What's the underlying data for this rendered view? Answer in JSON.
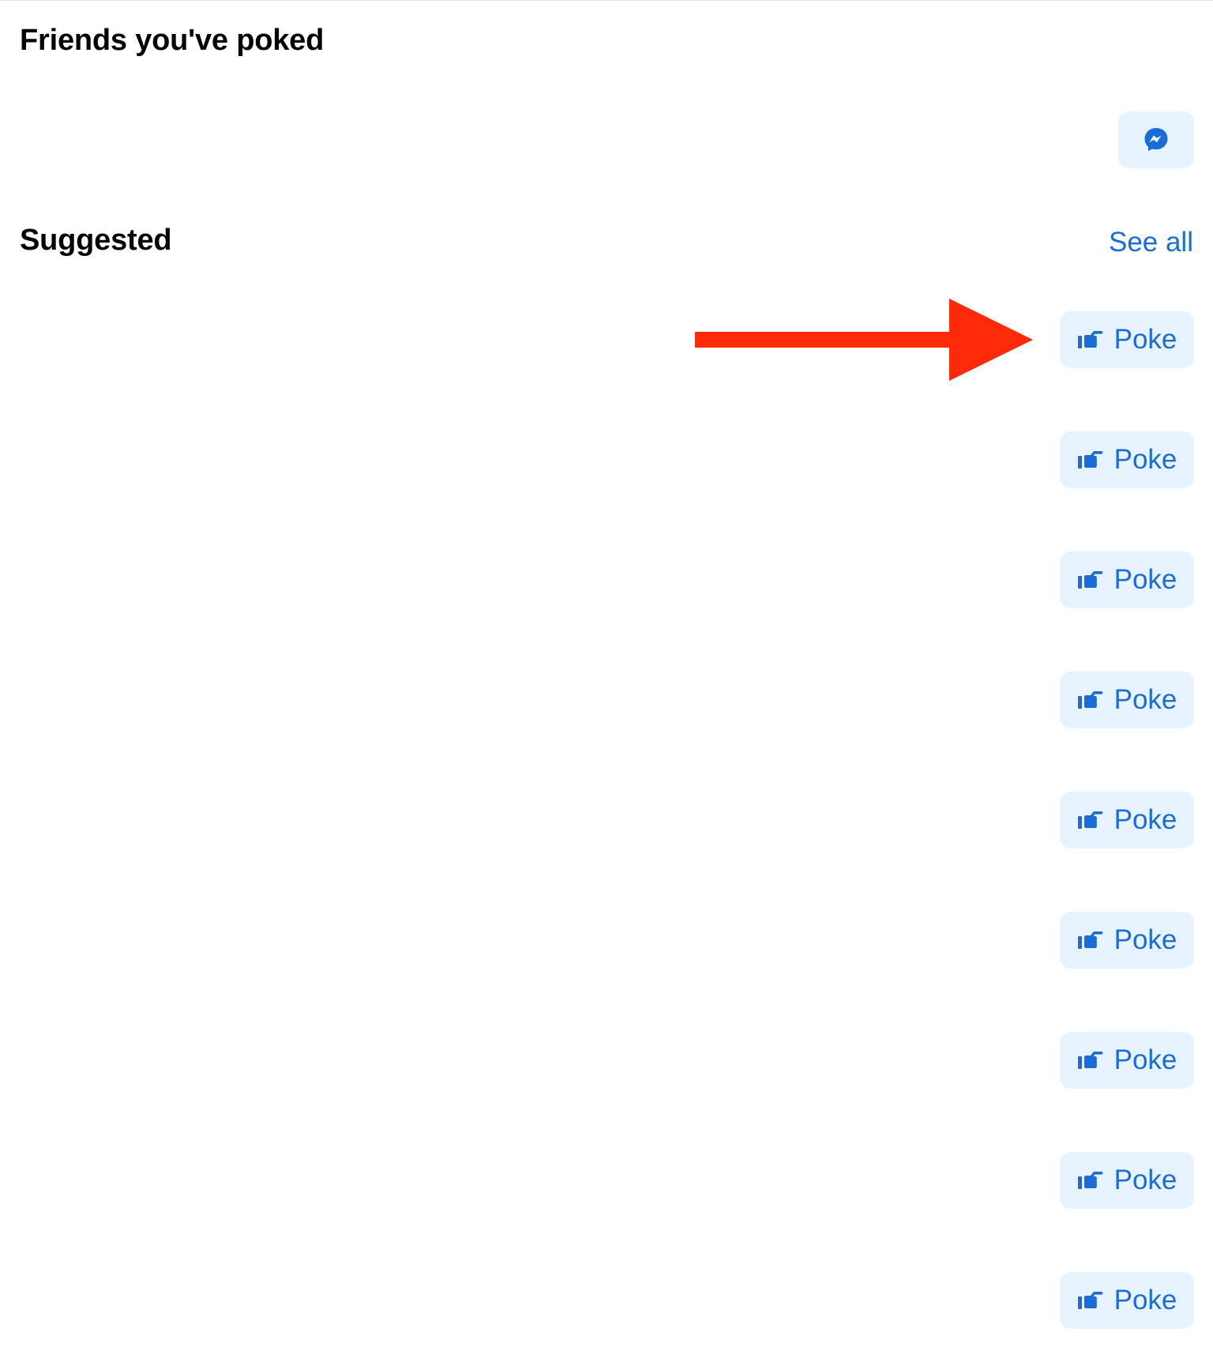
{
  "sections": {
    "poked_title": "Friends you've poked",
    "suggested_title": "Suggested",
    "see_all": "See all"
  },
  "poked_list": [
    {
      "action_icon": "messenger-icon"
    }
  ],
  "suggested_list": [
    {
      "button_label": "Poke",
      "icon": "poke-hand-icon"
    },
    {
      "button_label": "Poke",
      "icon": "poke-hand-icon"
    },
    {
      "button_label": "Poke",
      "icon": "poke-hand-icon"
    },
    {
      "button_label": "Poke",
      "icon": "poke-hand-icon"
    },
    {
      "button_label": "Poke",
      "icon": "poke-hand-icon"
    },
    {
      "button_label": "Poke",
      "icon": "poke-hand-icon"
    },
    {
      "button_label": "Poke",
      "icon": "poke-hand-icon"
    },
    {
      "button_label": "Poke",
      "icon": "poke-hand-icon"
    },
    {
      "button_label": "Poke",
      "icon": "poke-hand-icon"
    }
  ],
  "annotation": {
    "type": "arrow",
    "color": "#ff2a0a",
    "points_to": "first poke button"
  },
  "colors": {
    "accent": "#1b6cd6",
    "button_bg": "#e7f3ff",
    "text": "#050505"
  }
}
